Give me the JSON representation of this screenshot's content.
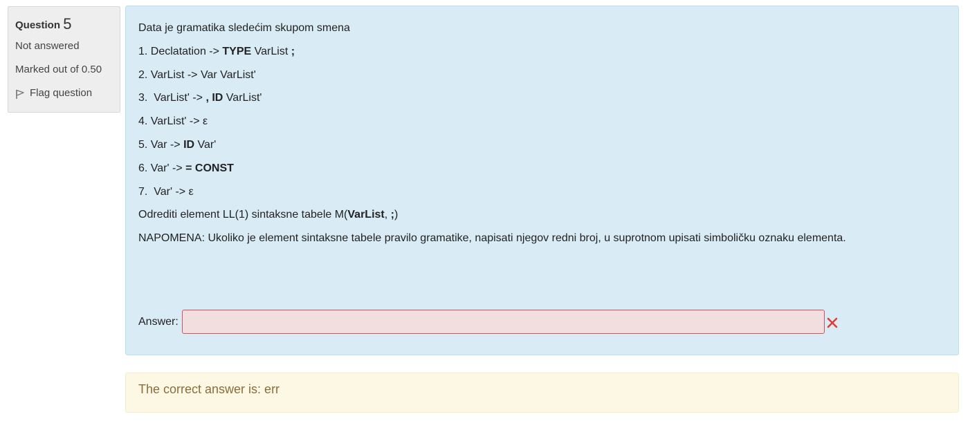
{
  "info": {
    "question_label": "Question",
    "question_number": "5",
    "state": "Not answered",
    "grade": "Marked out of 0.50",
    "flag_label": "Flag question"
  },
  "question": {
    "intro": "Data je gramatika sledećim skupom smena",
    "rules": [
      {
        "pre": "1. Declatation -> ",
        "b1": "TYPE",
        "mid": " VarList ",
        "b2": ";"
      },
      {
        "text": "2. VarList -> Var VarList'"
      },
      {
        "pre": "3.  VarList' -> ",
        "b1": ", ID",
        "mid": " VarList'"
      },
      {
        "text": "4. VarList' -> ε"
      },
      {
        "pre": "5. Var -> ",
        "b1": "ID",
        "mid": " Var'"
      },
      {
        "pre": "6. Var' -> ",
        "b1": "= CONST"
      },
      {
        "text": "7.  Var' -> ε"
      }
    ],
    "task": {
      "pre": "Odrediti element LL(1) sintaksne tabele M(",
      "b1": "VarList",
      "mid": ", ",
      "b2": ";",
      "post": ")"
    },
    "note": "NAPOMENA: Ukoliko je element sintaksne tabele pravilo gramatike, napisati njegov redni broj, u suprotnom upisati simboličku oznaku elementa."
  },
  "answer": {
    "label": "Answer:",
    "value": ""
  },
  "feedback": {
    "correct_answer": "The correct answer is: err"
  },
  "colors": {
    "content_bg": "#d9ebf5",
    "info_bg": "#eeeeee",
    "input_bg": "#f2dede",
    "input_border": "#d2525b",
    "incorrect": "#e53935",
    "feedback_bg": "#fcf8e3",
    "feedback_text": "#8a6d3b"
  },
  "icons": {
    "flag": "flag-icon",
    "incorrect": "cross-icon"
  }
}
